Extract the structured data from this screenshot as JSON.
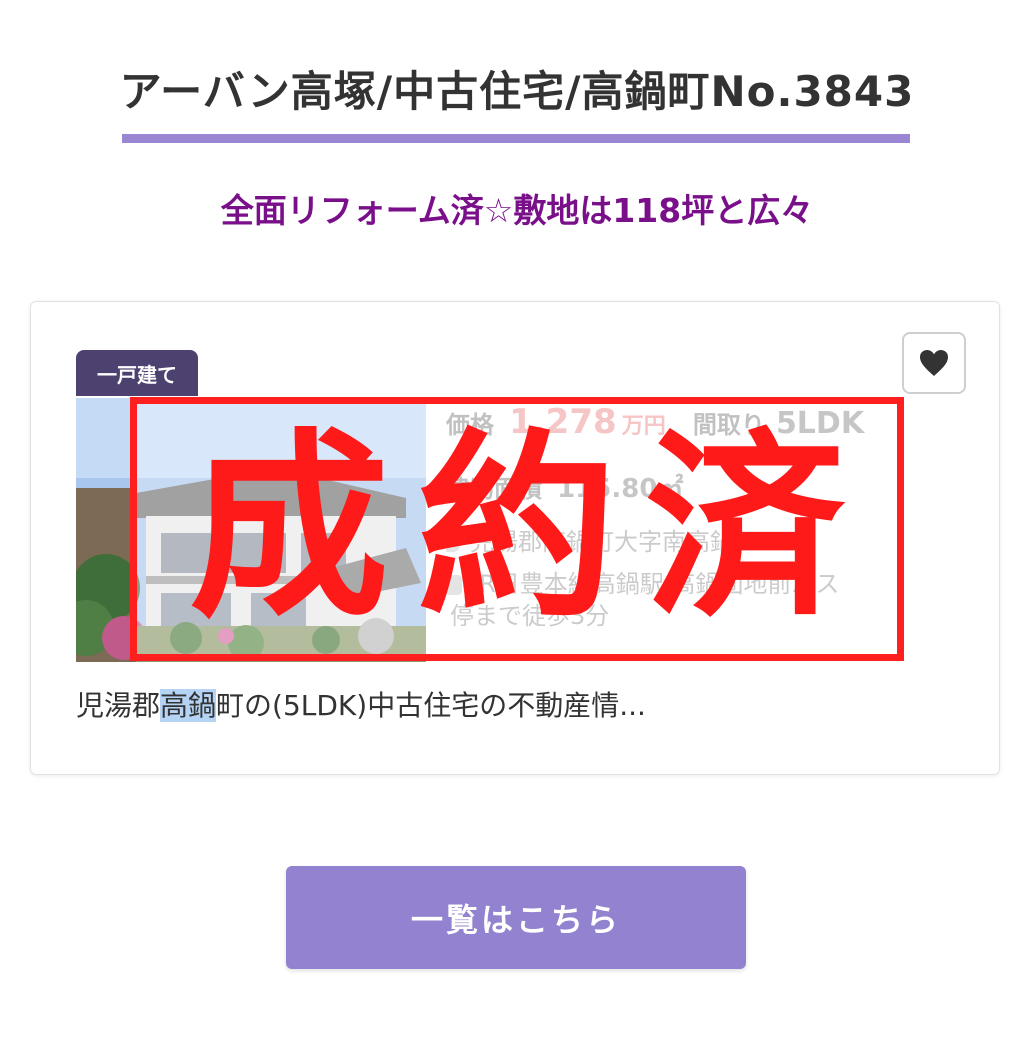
{
  "header": {
    "title": "アーバン高塚/中古住宅/高鍋町No.3843",
    "catchcopy": "全面リフォーム済☆敷地は118坪と広々"
  },
  "listing": {
    "category_badge": "一戸建て",
    "favorite_icon": "heart-icon",
    "price_label": "価格",
    "price_value": "1,278",
    "price_unit": "万円",
    "layout_label": "間取り",
    "layout_value": "5LDK",
    "area_label": "建物面積",
    "area_value": "115.80㎡",
    "address": "児湯郡高鍋町大字南高鍋",
    "access_line1": "JR日豊本線高鍋駅 高鍋団地前バス",
    "access_line2": "停まで徒歩3分",
    "sold_stamp": "成約済",
    "description_pre": "児湯郡",
    "description_highlight": "高鍋",
    "description_post": "町の(5LDK)中古住宅の不動産情..."
  },
  "footer": {
    "list_button_label": "一覧はこちら"
  },
  "colors": {
    "accent_underline": "#9a86d2",
    "catchcopy": "#7a0f8a",
    "badge_bg": "#4d4170",
    "sold_red": "#ff1f1f",
    "button_bg": "#9282cf"
  }
}
